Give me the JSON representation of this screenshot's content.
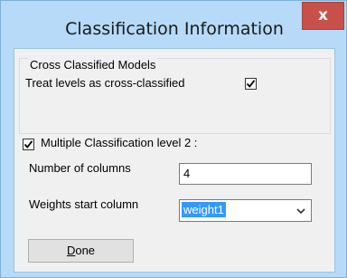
{
  "window": {
    "title": "Classification Information",
    "close_label": "x"
  },
  "cross_classified": {
    "group_title": "Cross Classified Models",
    "checkbox_label": "Treat levels as cross-classified",
    "checked": true
  },
  "multiple_classification": {
    "checkbox_label": "Multiple Classification level 2 :",
    "checked": true
  },
  "fields": {
    "num_columns_label": "Number of columns",
    "num_columns_value": "4",
    "weights_label": "Weights start column",
    "weights_value": "weight1"
  },
  "done_button": {
    "mnemonic": "D",
    "rest": "one"
  },
  "icons": {
    "close": "close-icon",
    "check": "checkmark-icon",
    "dropdown": "chevron-down-icon"
  }
}
